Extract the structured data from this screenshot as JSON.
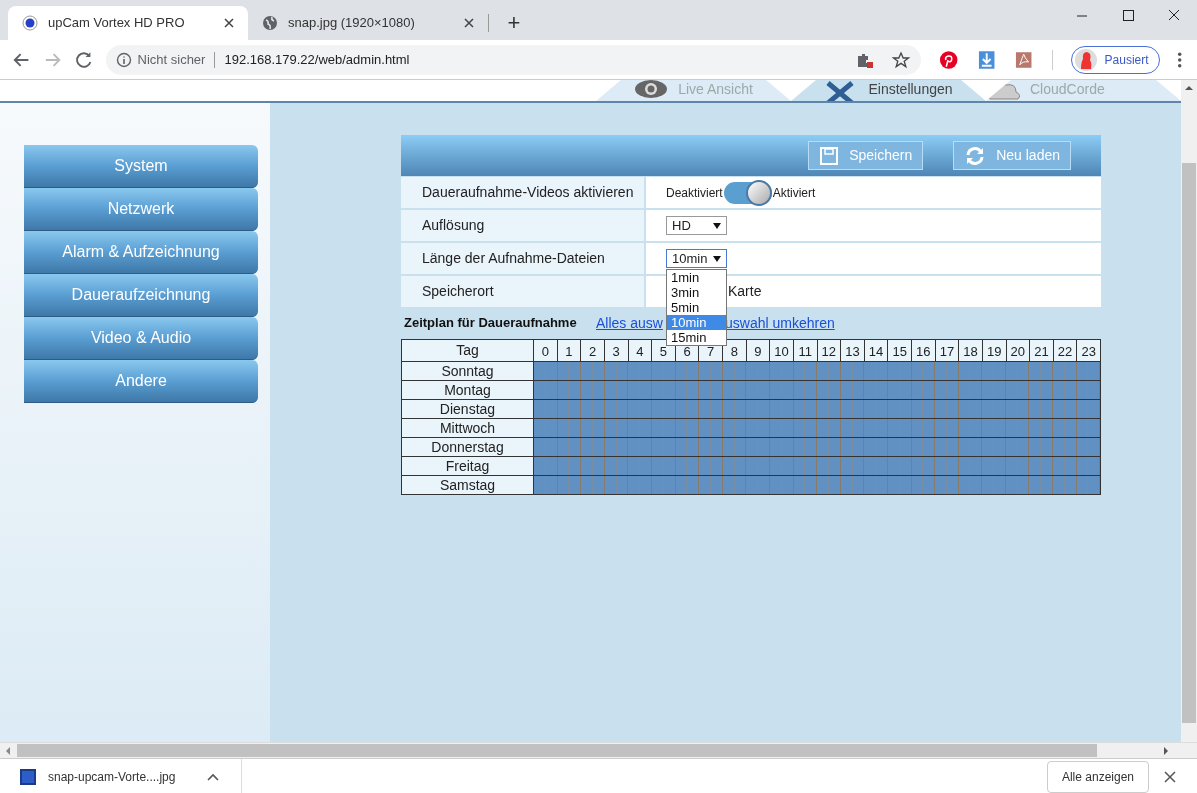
{
  "browser": {
    "tabs": [
      {
        "title": "upCam Vortex HD PRO",
        "selected": true
      },
      {
        "title": "snap.jpg (1920×1080)",
        "selected": false
      }
    ],
    "new_tab": "+",
    "security": "Nicht sicher",
    "url": "192.168.179.22/web/admin.html",
    "profile": "Pausiert"
  },
  "nav_tabs": [
    {
      "label": "Live Ansicht",
      "selected": false,
      "kind": "eye"
    },
    {
      "label": "Einstellungen",
      "selected": true,
      "kind": "tools"
    },
    {
      "label": "CloudCorde",
      "selected": false,
      "kind": "cloud"
    }
  ],
  "sidebar": [
    {
      "label": "System"
    },
    {
      "label": "Netzwerk"
    },
    {
      "label": "Alarm & Aufzeichnung"
    },
    {
      "label": "Daueraufzeichnung"
    },
    {
      "label": "Video & Audio"
    },
    {
      "label": "Andere"
    }
  ],
  "toolbar": [
    {
      "label": "Speichern",
      "kind": "save"
    },
    {
      "label": "Neu laden",
      "kind": "reload"
    }
  ],
  "settings": [
    {
      "label": "Daueraufnahme-Videos aktivieren",
      "kind": "toggle",
      "off_label": "Deaktiviert",
      "on_label": "Aktiviert",
      "on": true
    },
    {
      "label": "Auflösung",
      "kind": "select",
      "value": "HD",
      "open": false
    },
    {
      "label": "Länge der Aufnahme-Dateien",
      "kind": "select",
      "value": "10min",
      "open": true,
      "options": [
        {
          "label": "1min",
          "selected": false
        },
        {
          "label": "3min",
          "selected": false
        },
        {
          "label": "5min",
          "selected": false
        },
        {
          "label": "10min",
          "selected": true
        },
        {
          "label": "15min",
          "selected": false
        }
      ]
    },
    {
      "label": "Speicherort",
      "kind": "text",
      "value": "Karte"
    }
  ],
  "schedule": {
    "title": "Zeitplan für Daueraufnahme",
    "links": [
      "Alles ausw",
      "uswahl umkehren"
    ],
    "corner": "Tag",
    "hours": [
      "0",
      "1",
      "2",
      "3",
      "4",
      "5",
      "6",
      "7",
      "8",
      "9",
      "10",
      "11",
      "12",
      "13",
      "14",
      "15",
      "16",
      "17",
      "18",
      "19",
      "20",
      "21",
      "22",
      "23"
    ],
    "days": [
      {
        "label": "Sonntag",
        "active": true
      },
      {
        "label": "Montag",
        "active": true
      },
      {
        "label": "Dienstag",
        "active": true
      },
      {
        "label": "Mittwoch",
        "active": true
      },
      {
        "label": "Donnerstag",
        "active": true
      },
      {
        "label": "Freitag",
        "active": true
      },
      {
        "label": "Samstag",
        "active": true
      }
    ]
  },
  "downloads": {
    "file": "snap-upcam-Vorte....jpg",
    "show_all": "Alle anzeigen"
  }
}
